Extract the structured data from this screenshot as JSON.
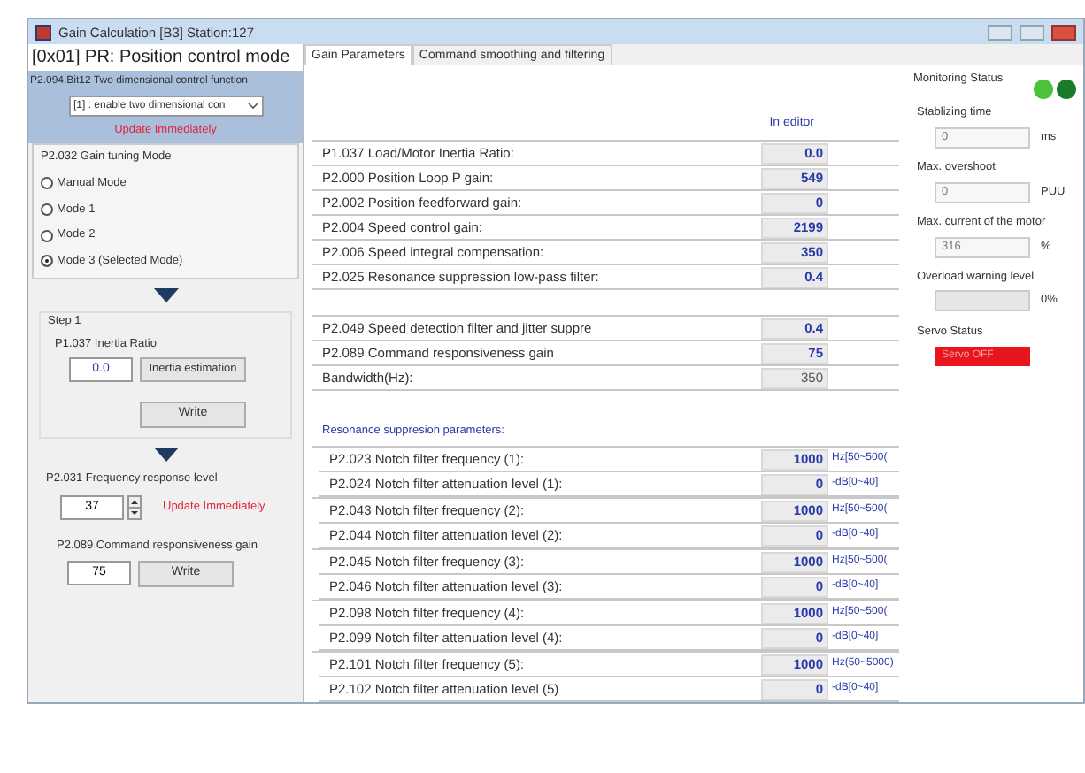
{
  "window": {
    "title": "Gain Calculation [B3] Station:127"
  },
  "left": {
    "mode_title": "[0x01] PR: Position control mode",
    "function_label": "P2.094.Bit12 Two dimensional control function",
    "function_value": "[1] : enable two dimensional con",
    "function_note": "Update Immediately",
    "tuning_label": "P2.032 Gain tuning Mode",
    "modes": [
      {
        "label": "Manual Mode",
        "selected": false
      },
      {
        "label": "Mode 1",
        "selected": false
      },
      {
        "label": "Mode 2",
        "selected": false
      },
      {
        "label": "Mode 3  (Selected Mode)",
        "selected": true
      }
    ],
    "step_title": "Step 1",
    "inertia_label": "P1.037 Inertia Ratio",
    "inertia_value": "0.0",
    "inertia_button": "Inertia estimation",
    "inertia_write": "Write",
    "freq_label": "P2.031 Frequency response level",
    "freq_value": "37",
    "freq_note": "Update Immediately",
    "cmd_label": "P2.089 Command responsiveness gain",
    "cmd_value": "75",
    "cmd_write": "Write"
  },
  "tabs": [
    {
      "label": "Gain Parameters",
      "selected": true
    },
    {
      "label": "Command smoothing and filtering",
      "selected": false
    }
  ],
  "column_header": "In editor",
  "groups": [
    [
      {
        "label": "P1.037 Load/Motor Inertia Ratio:",
        "value": "0.0"
      },
      {
        "label": "P2.000 Position Loop P gain:",
        "value": "549"
      },
      {
        "label": "P2.002 Position feedforward gain:",
        "value": "0"
      },
      {
        "label": "P2.004 Speed control gain:",
        "value": "2199"
      },
      {
        "label": "P2.006 Speed integral compensation:",
        "value": "350"
      },
      {
        "label": "P2.025 Resonance suppression low-pass filter:",
        "value": "0.4"
      }
    ],
    [
      {
        "label": "P2.049 Speed detection filter and jitter suppre",
        "value": "0.4"
      },
      {
        "label": "P2.089 Command responsiveness gain",
        "value": "75"
      },
      {
        "label": "Bandwidth(Hz):",
        "value": "350",
        "disabled": true
      }
    ]
  ],
  "resonance_title": "Resonance suppresion parameters:",
  "notches": [
    [
      {
        "label": "P2.023 Notch filter frequency (1):",
        "value": "1000",
        "unit": "Hz[50~500("
      },
      {
        "label": "P2.024 Notch filter attenuation level (1):",
        "value": "0",
        "unit": "-dB[0~40]"
      }
    ],
    [
      {
        "label": "P2.043 Notch filter frequency (2):",
        "value": "1000",
        "unit": "Hz[50~500("
      },
      {
        "label": "P2.044 Notch filter attenuation level (2):",
        "value": "0",
        "unit": "-dB[0~40]"
      }
    ],
    [
      {
        "label": "P2.045 Notch filter frequency (3):",
        "value": "1000",
        "unit": "Hz[50~500("
      },
      {
        "label": "P2.046 Notch filter attenuation level (3):",
        "value": "0",
        "unit": "-dB[0~40]"
      }
    ],
    [
      {
        "label": "P2.098 Notch filter frequency (4):",
        "value": "1000",
        "unit": "Hz[50~500("
      },
      {
        "label": "P2.099 Notch filter attenuation level (4):",
        "value": "0",
        "unit": "-dB[0~40]"
      }
    ],
    [
      {
        "label": "P2.101 Notch filter frequency (5):",
        "value": "1000",
        "unit": "Hz(50~5000)"
      },
      {
        "label": "P2.102 Notch filter attenuation level (5)",
        "value": "0",
        "unit": "-dB[0~40]"
      }
    ]
  ],
  "monitoring": {
    "title": "Monitoring Status",
    "lights": [
      {
        "color": "#4cc13c"
      },
      {
        "color": "#1a7a2a"
      }
    ],
    "fields": [
      {
        "label": "Stablizing time",
        "value": "0",
        "unit": "ms"
      },
      {
        "label": "Max. overshoot",
        "value": "0",
        "unit": "PUU"
      },
      {
        "label": "Max. current of the motor",
        "value": "316",
        "unit": "%"
      }
    ],
    "overload": {
      "label": "Overload warning level",
      "level": 0,
      "reading": "0%"
    },
    "servo": {
      "label": "Servo Status",
      "value": "Servo OFF"
    }
  }
}
